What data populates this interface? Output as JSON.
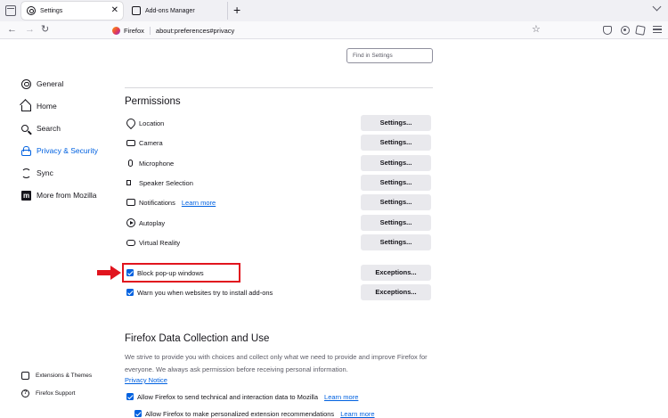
{
  "tabs": [
    {
      "label": "Settings",
      "icon": "gear-icon",
      "active": true
    },
    {
      "label": "Add-ons Manager",
      "icon": "puzzle-icon",
      "active": false
    }
  ],
  "tab_close_glyph": "✕",
  "new_tab_glyph": "+",
  "nav": {
    "back_glyph": "←",
    "forward_glyph": "→",
    "reload_glyph": "↻",
    "identity_label": "Firefox",
    "url": "about:preferences#privacy",
    "star_glyph": "☆"
  },
  "search": {
    "placeholder": "Find in Settings"
  },
  "sidebar": {
    "items": [
      {
        "label": "General",
        "icon": "gear-icon"
      },
      {
        "label": "Home",
        "icon": "home-icon"
      },
      {
        "label": "Search",
        "icon": "search-icon"
      },
      {
        "label": "Privacy & Security",
        "icon": "lock-icon",
        "selected": true
      },
      {
        "label": "Sync",
        "icon": "sync-icon"
      },
      {
        "label": "More from Mozilla",
        "icon": "mozilla-icon",
        "glyph": "m"
      }
    ],
    "footer": [
      {
        "label": "Extensions & Themes",
        "icon": "puzzle-icon"
      },
      {
        "label": "Firefox Support",
        "icon": "help-icon",
        "glyph": "?"
      }
    ]
  },
  "permissions": {
    "title": "Permissions",
    "rows": [
      {
        "label": "Location",
        "icon": "location-icon",
        "button": "Settings..."
      },
      {
        "label": "Camera",
        "icon": "camera-icon",
        "button": "Settings..."
      },
      {
        "label": "Microphone",
        "icon": "microphone-icon",
        "button": "Settings..."
      },
      {
        "label": "Speaker Selection",
        "icon": "speaker-icon",
        "button": "Settings..."
      },
      {
        "label": "Notifications",
        "icon": "notification-icon",
        "link": "Learn more",
        "button": "Settings..."
      },
      {
        "label": "Autoplay",
        "icon": "autoplay-icon",
        "button": "Settings..."
      },
      {
        "label": "Virtual Reality",
        "icon": "vr-icon",
        "button": "Settings..."
      }
    ],
    "checkboxes": [
      {
        "label": "Block pop-up windows",
        "checked": true,
        "button": "Exceptions..."
      },
      {
        "label": "Warn you when websites try to install add-ons",
        "checked": true,
        "button": "Exceptions..."
      }
    ]
  },
  "data_collection": {
    "title": "Firefox Data Collection and Use",
    "description": "We strive to provide you with choices and collect only what we need to provide and improve Firefox for everyone. We always ask permission before receiving personal information.",
    "privacy_link": "Privacy Notice",
    "options": [
      {
        "label": "Allow Firefox to send technical and interaction data to Mozilla",
        "checked": true,
        "link": "Learn more"
      },
      {
        "label": "Allow Firefox to make personalized extension recommendations",
        "checked": true,
        "link": "Learn more"
      }
    ]
  },
  "colors": {
    "accent": "#0061e0",
    "annotation": "#e1141e"
  }
}
